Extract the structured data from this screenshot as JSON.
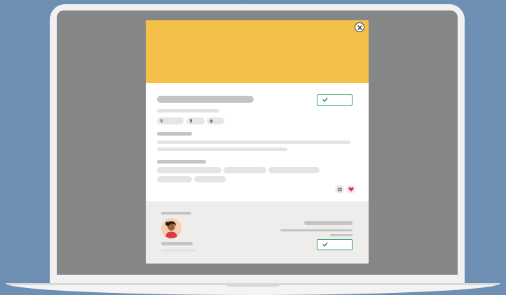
{
  "modal": {
    "close_icon": "close-icon",
    "primary_action": {
      "icon": "check-icon",
      "accent": "#2e9e6a"
    },
    "meta_pills": [
      {
        "icon": "location-pin-icon"
      },
      {
        "icon": "bookmark-icon"
      },
      {
        "icon": "briefcase-icon"
      }
    ],
    "tags_icons": [
      "hashtag-icon",
      "heart-icon"
    ],
    "footer": {
      "avatar": "avatar",
      "secondary_action": {
        "icon": "check-icon",
        "accent": "#2e9e6a"
      }
    }
  },
  "colors": {
    "banner": "#f5c04a",
    "background": "#6d8fb3",
    "screen": "#858688",
    "heart": "#e0304b"
  }
}
